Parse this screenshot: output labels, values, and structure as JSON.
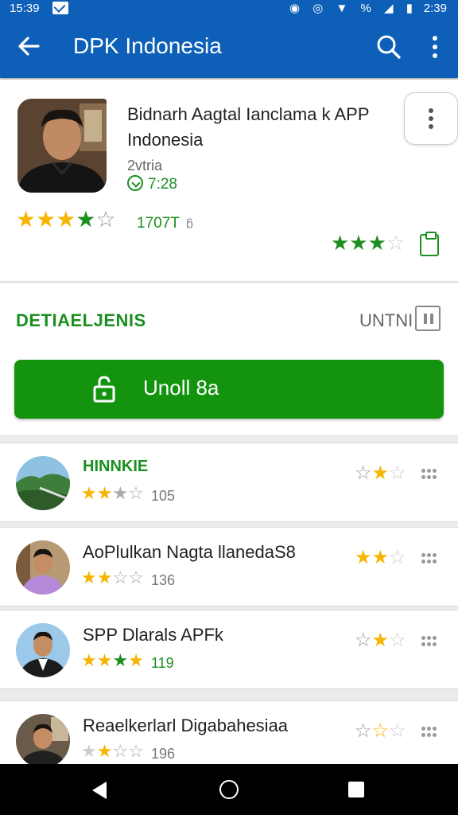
{
  "status_bar": {
    "time_left": "15:39",
    "time_right": "2:39",
    "icons": "◉ ◎ ▼ % ◢ ▮"
  },
  "app_bar": {
    "title": "DPK Indonesia"
  },
  "app": {
    "title": "Bidnarh Aagtal Ianclama k APP Indonesia",
    "subtitle": "2vtria",
    "size": "7:28",
    "rating_stars": "★★★★☆",
    "rating_count": "1707T",
    "rating_info": "ᵷ",
    "secondary_stars": "★★★☆"
  },
  "detail": {
    "label": "DETIAELJENIS",
    "right_label": "UNTNI"
  },
  "install": {
    "label": "Unoll  8a"
  },
  "list": [
    {
      "name": "HINNKIE",
      "stars": "★★★☆",
      "count": "105",
      "rstars": "☆★☆"
    },
    {
      "name": "AoPlulkan Nagta llanedaS8",
      "stars": "★★☆☆",
      "count": "136",
      "rstars": "★★☆"
    },
    {
      "name": "SPP Dlarals APFk",
      "stars": "★★★★",
      "count": "119",
      "rstars": "☆★☆"
    },
    {
      "name": "Reaelkerlarl Digabahesiaa",
      "stars": "★★★☆",
      "count": "196",
      "rstars": "☆★☆"
    }
  ]
}
